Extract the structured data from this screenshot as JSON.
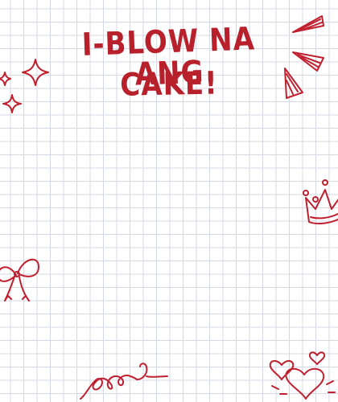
{
  "card": {
    "title_line1": "i-BLOW NA ANG",
    "title_line2": "CAKE!"
  },
  "colors": {
    "accent": "#b8202c",
    "grid": "#d5d9e6",
    "background": "#ffffff"
  },
  "decorations": [
    "sparkle-star-icon",
    "burst-lines-icon",
    "crown-icon",
    "ribbon-bow-icon",
    "curly-loops-icon",
    "hearts-icon"
  ]
}
